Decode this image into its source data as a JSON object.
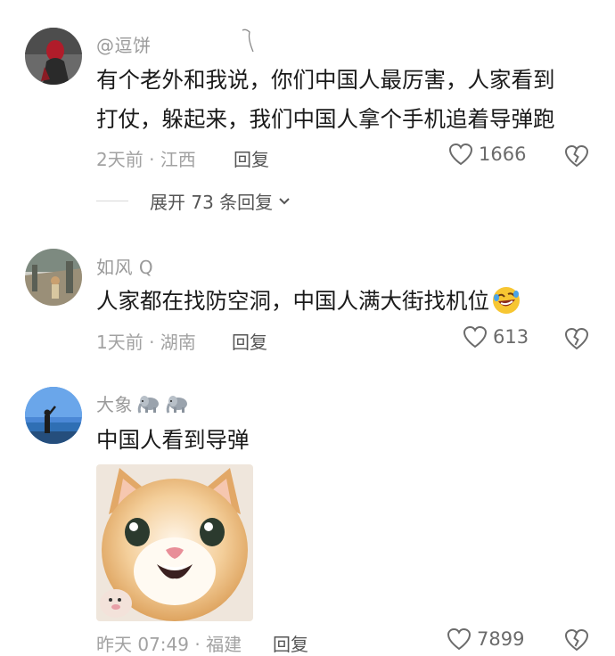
{
  "comments": [
    {
      "username": "@逗饼",
      "lines": [
        "有个老外和我说，你们中国人最厉害，人家看到",
        "打仗，躲起来，我们中国人拿个手机追着导弹跑"
      ],
      "time_location": "2天前 · 江西",
      "reply_label": "回复",
      "likes": "1666",
      "expand_label": "展开 73 条回复"
    },
    {
      "username": "如风 Q",
      "lines": [
        "人家都在找防空洞，中国人满大街找机位"
      ],
      "time_location": "1天前 · 湖南",
      "reply_label": "回复",
      "likes": "613"
    },
    {
      "username": "大象",
      "lines": [
        "中国人看到导弹"
      ],
      "time_location": "昨天 07:49 · 福建",
      "reply_label": "回复",
      "likes": "7899"
    }
  ],
  "icons": {
    "like": "heart-outline-icon",
    "dislike": "broken-heart-icon",
    "expand": "chevron-down-icon",
    "emoji_laugh": "rofl-emoji",
    "emoji_elephant": "elephant-emoji"
  },
  "colors": {
    "text": "#1a1a1a",
    "meta": "#a2a2a2",
    "username": "#9a9a9a",
    "icon": "#6b6b6b"
  }
}
